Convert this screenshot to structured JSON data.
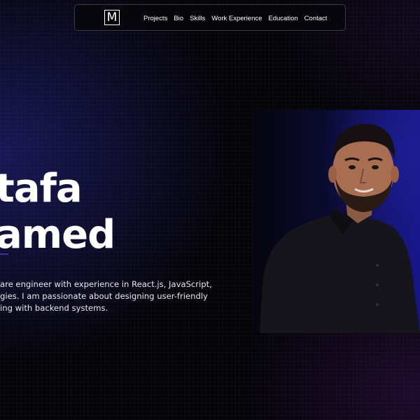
{
  "nav": {
    "logo": "M",
    "links": [
      "Projects",
      "Bio",
      "Skills",
      "Work Experience",
      "Education",
      "Contact"
    ]
  },
  "hero": {
    "name_line_1": "tafa",
    "name_line_2": "amed",
    "description_lines": [
      "are engineer with experience in React.js, JavaScript,",
      "gies. I am passionate about designing user-friendly",
      "ing with backend systems."
    ]
  },
  "colors": {
    "background": "#050409",
    "accent_blue": "#1d1e92",
    "text": "#ffffff"
  }
}
